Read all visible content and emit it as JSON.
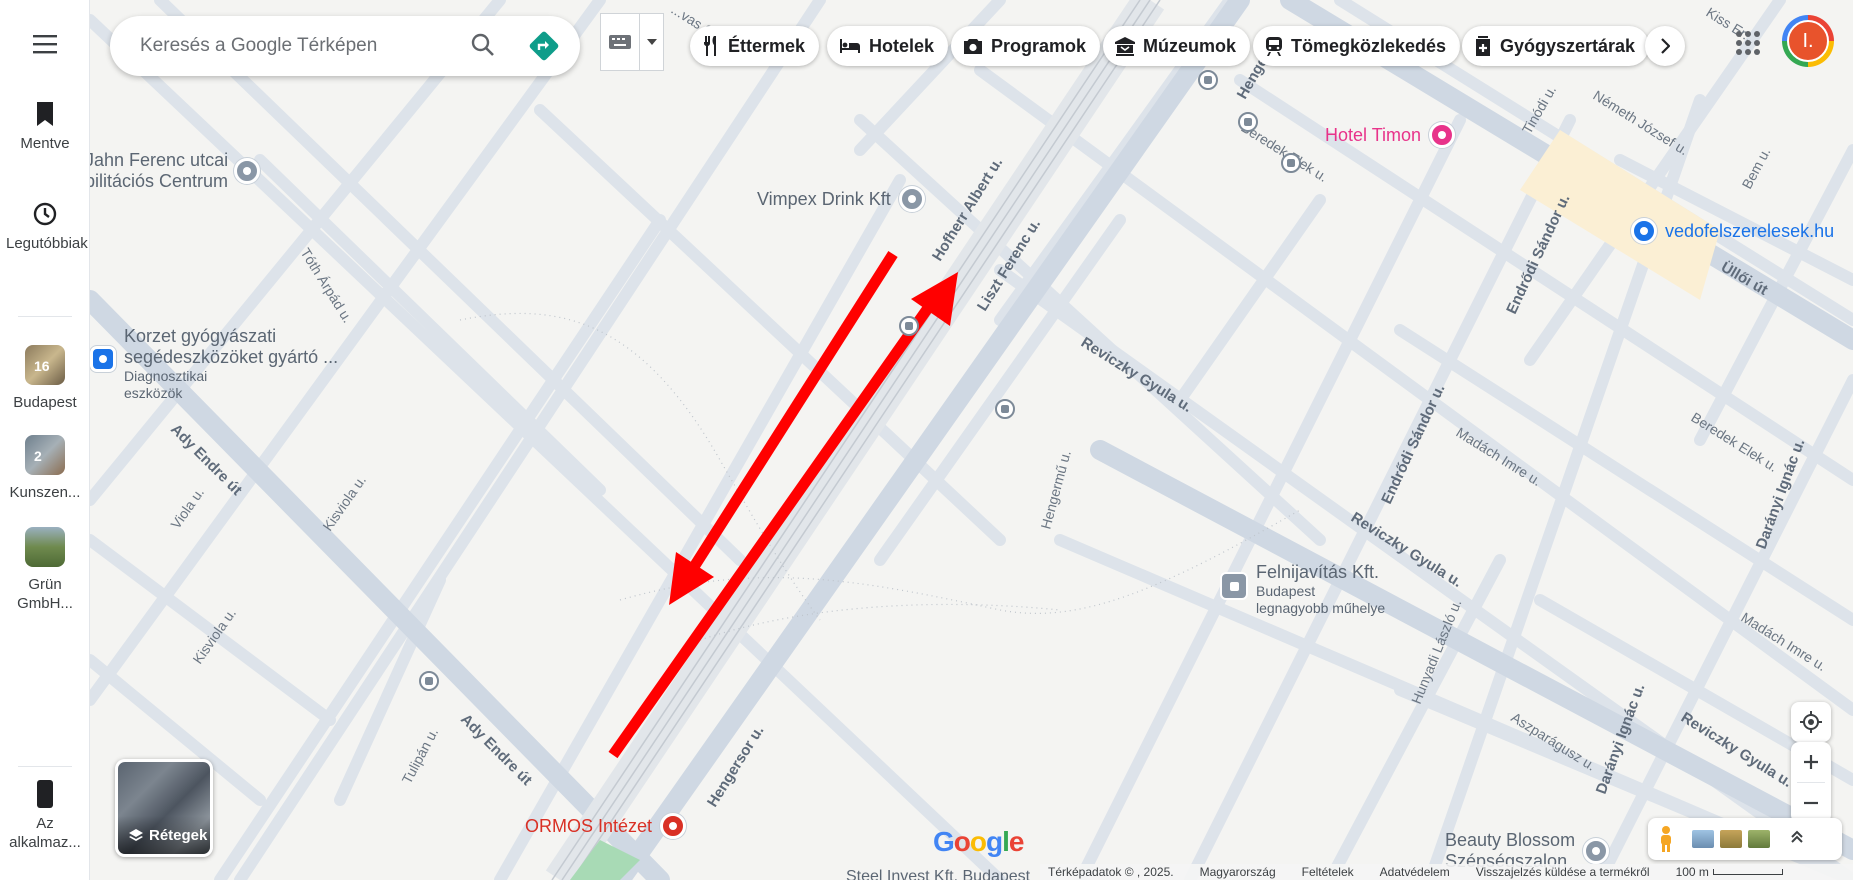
{
  "search": {
    "placeholder": "Keresés a Google Térképen"
  },
  "rail": {
    "saved": "Mentve",
    "recent": "Legutóbbiak",
    "lists": [
      {
        "label": "Budapest",
        "count": "16"
      },
      {
        "label": "Kunszen...",
        "count": "2"
      },
      {
        "label": "Grün GmbH..."
      }
    ],
    "app": "Az alkalmaz..."
  },
  "chips": [
    "Éttermek",
    "Hotelek",
    "Programok",
    "Múzeumok",
    "Tömegközlekedés",
    "Gyógyszertárak"
  ],
  "account": {
    "initial": "I."
  },
  "layers": {
    "label": "Rétegek"
  },
  "streets": {
    "hofherr": "Hofherr Albert u.",
    "liszt": "Liszt Ferenc u.",
    "reviczky1": "Reviczky Gyula u.",
    "reviczky2": "Reviczky Gyula u.",
    "reviczky3": "Reviczky Gyula u.",
    "ady1": "Ady Endre út",
    "ady2": "Ady Endre út",
    "hengersor": "Hengersor u.",
    "hengermu": "Hengermű u.",
    "endrodi1": "Endrődi Sándor u.",
    "endrodi2": "Endrődi Sándor u.",
    "madach1": "Madách Imre u.",
    "madach2": "Madách Imre u.",
    "beredek1": "Beredek Elek u.",
    "beredek2": "Beredek Elek u.",
    "daranyi1": "Darányi Ignác u.",
    "daranyi2": "Darányi Ignác u.",
    "ulloi": "Üllői út",
    "tinodi": "Tinódi u.",
    "nemeth": "Németh József u.",
    "toth": "Tóth Árpád u.",
    "viola": "Viola u.",
    "kisviola1": "Kisviola u.",
    "kisviola2": "Kisviola u.",
    "tulipan": "Tulipán u.",
    "hunyadi": "Hunyadi László u.",
    "aszparagusz": "Aszparágusz u.",
    "kiss": "Kiss Er...",
    "bem": "Bem u.",
    "henge": "Henge...",
    "vasgy": "...vas Gy..."
  },
  "pois": {
    "jahn": "Jahn Ferenc utcai\nbilitációs Centrum",
    "vimpex": "Vimpex Drink Kft",
    "korzet": "Korzet gyógyászati\nsegédeszközöket gyártó ...",
    "korzet_sub": "Diagnosztikai\neszközök",
    "timon": "Hotel Timon",
    "vedo": "vedofelszerelesek.hu",
    "felni": "Felnijavítás Kft.",
    "felni_sub": "Budapest\nlegnagyobb műhelye",
    "ormos": "ORMOS Intézet",
    "beauty": "Beauty Blossom\nSzépségszalon",
    "steel": "Steel Invest Kft. Budapest"
  },
  "footer": {
    "mapdata": "Térképadatok © , 2025.",
    "country": "Magyarország",
    "terms": "Feltételek",
    "privacy": "Adatvédelem",
    "feedback": "Visszajelzés küldése a termékről",
    "scale": "100 m"
  },
  "brand": {
    "google": "Google"
  },
  "colors": {
    "arrow": "#ff0000",
    "blue_poi": "#1a73e8",
    "pink_poi": "#e8338a",
    "red_poi": "#d93025",
    "directions": "#0f9d8a"
  }
}
